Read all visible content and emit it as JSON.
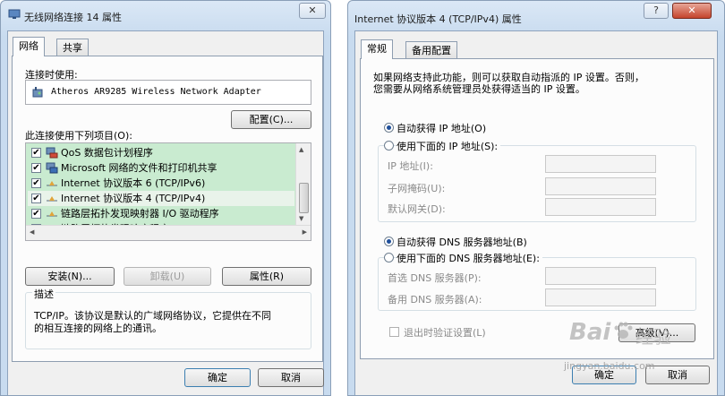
{
  "win1": {
    "title": "无线网络连接 14 属性",
    "close_glyph": "✕",
    "tabs": [
      "网络",
      "共享"
    ],
    "connect_using_label": "连接时使用:",
    "adapter_name": "Atheros AR9285 Wireless Network Adapter",
    "configure_button": "配置(C)...",
    "items_label": "此连接使用下列项目(O):",
    "items": [
      {
        "label": "QoS 数据包计划程序",
        "checked": true,
        "icon": "qos-icon"
      },
      {
        "label": "Microsoft 网络的文件和打印机共享",
        "checked": true,
        "icon": "file-sharing-icon"
      },
      {
        "label": "Internet 协议版本 6 (TCP/IPv6)",
        "checked": true,
        "icon": "protocol-icon"
      },
      {
        "label": "Internet 协议版本 4 (TCP/IPv4)",
        "checked": true,
        "icon": "protocol-icon"
      },
      {
        "label": "链路层拓扑发现映射器 I/O 驱动程序",
        "checked": true,
        "icon": "protocol-icon"
      },
      {
        "label": "链路层拓扑发现响应程序",
        "checked": true,
        "icon": "protocol-icon"
      }
    ],
    "install_button": "安装(N)...",
    "uninstall_button": "卸载(U)",
    "properties_button": "属性(R)",
    "description_title": "描述",
    "description_text_1": "TCP/IP。该协议是默认的广域网络协议，它提供在不同",
    "description_text_2": "的相互连接的网络上的通讯。",
    "ok_button": "确定",
    "cancel_button": "取消"
  },
  "win2": {
    "title": "Internet 协议版本 4 (TCP/IPv4) 属性",
    "help_glyph": "?",
    "close_glyph": "✕",
    "tabs": [
      "常规",
      "备用配置"
    ],
    "intro_1": "如果网络支持此功能，则可以获取自动指派的 IP 设置。否则，",
    "intro_2": "您需要从网络系统管理员处获得适当的 IP 设置。",
    "auto_ip": "自动获得 IP 地址(O)",
    "manual_ip": "使用下面的 IP 地址(S):",
    "ip_address": "IP 地址(I):",
    "subnet_mask": "子网掩码(U):",
    "default_gateway": "默认网关(D):",
    "auto_dns": "自动获得 DNS 服务器地址(B)",
    "manual_dns": "使用下面的 DNS 服务器地址(E):",
    "preferred_dns": "首选 DNS 服务器(P):",
    "alternate_dns": "备用 DNS 服务器(A):",
    "validate_on_exit": "退出时验证设置(L)",
    "advanced_button": "高级(V)...",
    "ok_button": "确定",
    "cancel_button": "取消",
    "auto_ip_selected": true,
    "auto_dns_selected": true
  },
  "watermark": {
    "brand": "Bai",
    "suffix": "经验",
    "url": "jingyan.baidu.com"
  },
  "colors": {
    "list_bg": "#c9ebd0",
    "title_bg": "#c8dbef",
    "radio_dot": "#1f4f9a"
  }
}
